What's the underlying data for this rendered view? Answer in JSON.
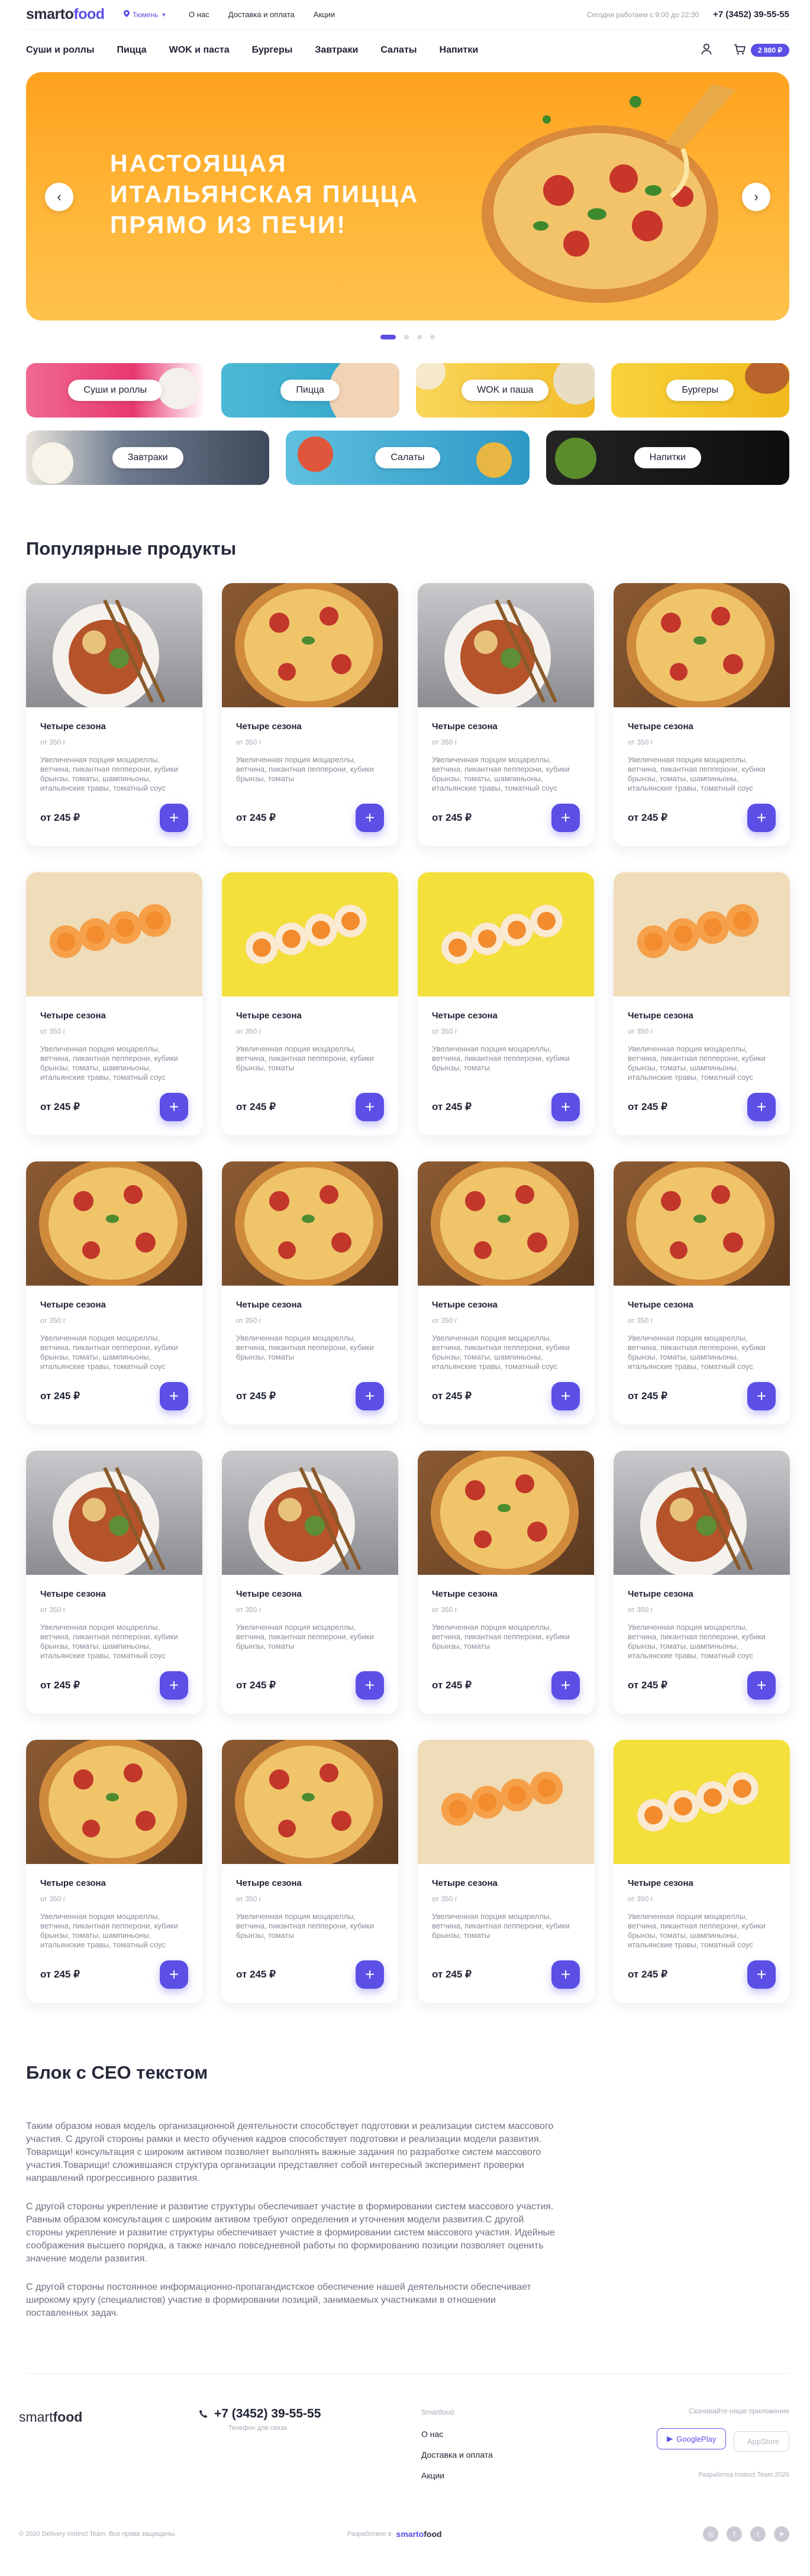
{
  "header": {
    "logo_pre": "smarto",
    "logo_post": "food",
    "city": "Тюмень",
    "top_links": [
      "О нас",
      "Доставка и оплата",
      "Акции"
    ],
    "hours": "Сегодня работаем с 9:00 до 22:30",
    "phone": "+7 (3452) 39-55-55",
    "nav": [
      "Суши и роллы",
      "Пицца",
      "WOK и паста",
      "Бургеры",
      "Завтраки",
      "Салаты",
      "Напитки"
    ],
    "cart_total": "2 880 ₽"
  },
  "hero": {
    "title_lines": [
      "НАСТОЯЩАЯ",
      "ИТАЛЬЯНСКАЯ ПИЦЦА",
      "ПРЯМО ИЗ ПЕЧИ!"
    ],
    "slides_total": 4,
    "active_slide": 1
  },
  "categories": [
    {
      "label": "Суши и роллы",
      "color": "#e94378"
    },
    {
      "label": "Пицца",
      "color": "#3fb1cf"
    },
    {
      "label": "WOK и паша",
      "color": "#f6c83a"
    },
    {
      "label": "Бургеры",
      "color": "#f7c829"
    },
    {
      "label": "Завтраки",
      "color": "#7b8a9d"
    },
    {
      "label": "Салаты",
      "color": "#42a7cf"
    },
    {
      "label": "Напитки",
      "color": "#1a1a1a"
    }
  ],
  "products_section": {
    "title": "Популярные продукты",
    "products": [
      {
        "img": "bowl",
        "name": "Четыре сезона",
        "weight": "от 350 г",
        "desc": "Увеличенная порция моцареллы, ветчина, пикантная пепперони, кубики брынзы, томаты, шампиньоны, итальянские травы, томатный соус",
        "price": "от 245 ₽"
      },
      {
        "img": "pizza",
        "name": "Четыре сезона",
        "weight": "от 350 г",
        "desc": "Увеличенная порция моцареллы, ветчина, пикантная пепперони, кубики брынзы, томаты",
        "price": "от 245 ₽"
      },
      {
        "img": "bowl",
        "name": "Четыре сезона",
        "weight": "от 350 г",
        "desc": "Увеличенная порция моцареллы, ветчина, пикантная пепперони, кубики брынзы, томаты, шампиньоны, итальянские травы, томатный соус",
        "price": "от 245 ₽"
      },
      {
        "img": "pizza",
        "name": "Четыре сезона",
        "weight": "от 350 г",
        "desc": "Увеличенная порция моцареллы, ветчина, пикантная пепперони, кубики брынзы, томаты, шампиньоны, итальянские травы, томатный соус",
        "price": "от 245 ₽"
      },
      {
        "img": "sushi-beige",
        "name": "Четыре сезона",
        "weight": "от 350 г",
        "desc": "Увеличенная порция моцареллы, ветчина, пикантная пепперони, кубики брынзы, томаты, шампиньоны, итальянские травы, томатный соус",
        "price": "от 245 ₽"
      },
      {
        "img": "sushi-yellow",
        "name": "Четыре сезона",
        "weight": "от 350 г",
        "desc": "Увеличенная порция моцареллы, ветчина, пикантная пепперони, кубики брынзы, томаты",
        "price": "от 245 ₽"
      },
      {
        "img": "sushi-yellow",
        "name": "Четыре сезона",
        "weight": "от 350 г",
        "desc": "Увеличенная порция моцареллы, ветчина, пикантная пепперони, кубики брынзы, томаты",
        "price": "от 245 ₽"
      },
      {
        "img": "sushi-beige",
        "name": "Четыре сезона",
        "weight": "от 350 г",
        "desc": "Увеличенная порция моцареллы, ветчина, пикантная пепперони, кубики брынзы, томаты, шампиньоны, итальянские травы, томатный соус",
        "price": "от 245 ₽"
      },
      {
        "img": "pizza",
        "name": "Четыре сезона",
        "weight": "от 350 г",
        "desc": "Увеличенная порция моцареллы, ветчина, пикантная пепперони, кубики брынзы, томаты, шампиньоны, итальянские травы, томатный соус",
        "price": "от 245 ₽"
      },
      {
        "img": "pizza",
        "name": "Четыре сезона",
        "weight": "от 350 г",
        "desc": "Увеличенная порция моцареллы, ветчина, пикантная пепперони, кубики брынзы, томаты",
        "price": "от 245 ₽"
      },
      {
        "img": "pizza",
        "name": "Четыре сезона",
        "weight": "от 350 г",
        "desc": "Увеличенная порция моцареллы, ветчина, пикантная пепперони, кубики брынзы, томаты, шампиньоны, итальянские травы, томатный соус",
        "price": "от 245 ₽"
      },
      {
        "img": "pizza",
        "name": "Четыре сезона",
        "weight": "от 350 г",
        "desc": "Увеличенная порция моцареллы, ветчина, пикантная пепперони, кубики брынзы, томаты, шампиньоны, итальянские травы, томатный соус",
        "price": "от 245 ₽"
      },
      {
        "img": "bowl",
        "name": "Четыре сезона",
        "weight": "от 350 г",
        "desc": "Увеличенная порция моцареллы, ветчина, пикантная пепперони, кубики брынзы, томаты, шампиньоны, итальянские травы, томатный соус",
        "price": "от 245 ₽"
      },
      {
        "img": "bowl",
        "name": "Четыре сезона",
        "weight": "от 350 г",
        "desc": "Увеличенная порция моцареллы, ветчина, пикантная пепперони, кубики брынзы, томаты",
        "price": "от 245 ₽"
      },
      {
        "img": "pizza",
        "name": "Четыре сезона",
        "weight": "от 350 г",
        "desc": "Увеличенная порция моцареллы, ветчина, пикантная пепперони, кубики брынзы, томаты",
        "price": "от 245 ₽"
      },
      {
        "img": "bowl",
        "name": "Четыре сезона",
        "weight": "от 350 г",
        "desc": "Увеличенная порция моцареллы, ветчина, пикантная пепперони, кубики брынзы, томаты, шампиньоны, итальянские травы, томатный соус",
        "price": "от 245 ₽"
      },
      {
        "img": "pizza",
        "name": "Четыре сезона",
        "weight": "от 350 г",
        "desc": "Увеличенная порция моцареллы, ветчина, пикантная пепперони, кубики брынзы, томаты, шампиньоны, итальянские травы, томатный соус",
        "price": "от 245 ₽"
      },
      {
        "img": "pizza",
        "name": "Четыре сезона",
        "weight": "от 350 г",
        "desc": "Увеличенная порция моцареллы, ветчина, пикантная пепперони, кубики брынзы, томаты",
        "price": "от 245 ₽"
      },
      {
        "img": "sushi-beige",
        "name": "Четыре сезона",
        "weight": "от 350 г",
        "desc": "Увеличенная порция моцареллы, ветчина, пикантная пепперони, кубики брынзы, томаты",
        "price": "от 245 ₽"
      },
      {
        "img": "sushi-yellow",
        "name": "Четыре сезона",
        "weight": "от 350 г",
        "desc": "Увеличенная порция моцареллы, ветчина, пикантная пепперони, кубики брынзы, томаты, шампиньоны, итальянские травы, томатный соус",
        "price": "от 245 ₽"
      }
    ]
  },
  "seo": {
    "title": "Блок с СЕО текстом",
    "paragraphs": [
      "Таким образом новая модель организационной деятельности способствует подготовки и реализации систем массового участия. С другой стороны рамки и место обучения кадров способствует подготовки и реализации модели развития. Товарищи! консультация с широким активом позволяет выполнять важные задания по разработке систем массового участия.Товарищи! сложившаяся структура организации представляет собой интересный эксперимент проверки направлений прогрессивного развития.",
      "С другой стороны укрепление и развитие структуры обеспечивает участие в формировании систем массового участия. Равным образом консультация с широким активом требуют определения и уточнения модели развития.С другой стороны укрепление и развитие структуры обеспечивает участие в формировании систем массового участия. Идейные соображения высшего порядка, а также начало повседневной работы по формированию позиции позволяет оценить значение модели развития.",
      "С другой стороны постоянное информационно-пропагандистское обеспечение нашей деятельности обеспечивает широкому кругу (специалистов) участие в формировании позиций, занимаемых участниками в отношении поставленных задач."
    ]
  },
  "footer": {
    "logo_pre": "smart",
    "logo_post": "food",
    "phone": "+7 (3452) 39-55-55",
    "phone_note": "Телефон для связи",
    "links_head": "Smartfood",
    "links": [
      "О нас",
      "Доставка и оплата",
      "Акции"
    ],
    "apps_head": "Скачивайте наше приложение",
    "google": "GooglePlay",
    "apple": "AppStore",
    "dev": "Разработка Instinct Team 2020",
    "copyright": "© 2020 Delivery Instinct Team. Все права защищены.",
    "made_by": "Разработано в",
    "made_brand_pre": "smarto",
    "made_brand_post": "food"
  }
}
